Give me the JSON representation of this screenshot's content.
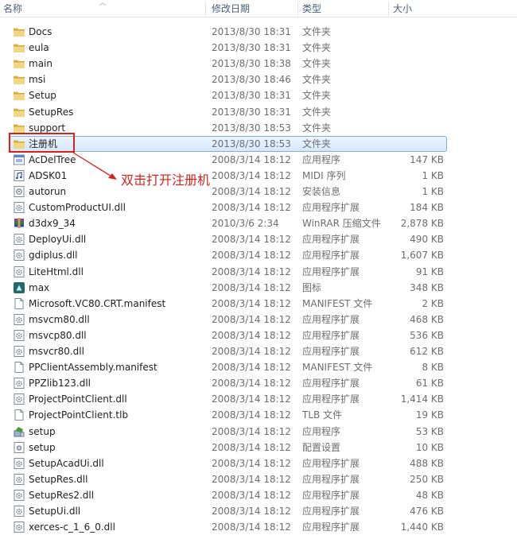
{
  "columns": {
    "name": "名称",
    "date": "修改日期",
    "type": "类型",
    "size": "大小"
  },
  "annotation": {
    "text": "双击打开注册机",
    "color": "#d9211c"
  },
  "colors": {
    "selection_border": "#84acdd",
    "folder": "#e9c45a",
    "header_text": "#4c607a"
  },
  "files": [
    {
      "name": "Docs",
      "date": "2013/8/30 18:31",
      "type": "文件夹",
      "size": "",
      "icon": "folder-icon"
    },
    {
      "name": "eula",
      "date": "2013/8/30 18:31",
      "type": "文件夹",
      "size": "",
      "icon": "folder-icon"
    },
    {
      "name": "main",
      "date": "2013/8/30 18:38",
      "type": "文件夹",
      "size": "",
      "icon": "folder-icon"
    },
    {
      "name": "msi",
      "date": "2013/8/30 18:46",
      "type": "文件夹",
      "size": "",
      "icon": "folder-icon"
    },
    {
      "name": "Setup",
      "date": "2013/8/30 18:31",
      "type": "文件夹",
      "size": "",
      "icon": "folder-icon"
    },
    {
      "name": "SetupRes",
      "date": "2013/8/30 18:31",
      "type": "文件夹",
      "size": "",
      "icon": "folder-icon"
    },
    {
      "name": "support",
      "date": "2013/8/30 18:53",
      "type": "文件夹",
      "size": "",
      "icon": "folder-icon"
    },
    {
      "name": "注册机",
      "date": "2013/8/30 18:53",
      "type": "文件夹",
      "size": "",
      "icon": "folder-icon",
      "selected": true
    },
    {
      "name": "AcDelTree",
      "date": "2008/3/14 18:12",
      "type": "应用程序",
      "size": "147 KB",
      "icon": "exe-icon"
    },
    {
      "name": "ADSK01",
      "date": "2008/3/14 18:12",
      "type": "MIDI 序列",
      "size": "1 KB",
      "icon": "midi-icon"
    },
    {
      "name": "autorun",
      "date": "2008/3/14 18:12",
      "type": "安装信息",
      "size": "1 KB",
      "icon": "inf-icon"
    },
    {
      "name": "CustomProductUI.dll",
      "date": "2008/3/14 18:12",
      "type": "应用程序扩展",
      "size": "184 KB",
      "icon": "dll-icon"
    },
    {
      "name": "d3dx9_34",
      "date": "2010/3/6 2:34",
      "type": "WinRAR 压缩文件",
      "size": "2,878 KB",
      "icon": "rar-icon"
    },
    {
      "name": "DeployUi.dll",
      "date": "2008/3/14 18:12",
      "type": "应用程序扩展",
      "size": "490 KB",
      "icon": "dll-icon"
    },
    {
      "name": "gdiplus.dll",
      "date": "2008/3/14 18:12",
      "type": "应用程序扩展",
      "size": "1,607 KB",
      "icon": "dll-icon"
    },
    {
      "name": "LiteHtml.dll",
      "date": "2008/3/14 18:12",
      "type": "应用程序扩展",
      "size": "91 KB",
      "icon": "dll-icon"
    },
    {
      "name": "max",
      "date": "2008/3/14 18:12",
      "type": "图标",
      "size": "348 KB",
      "icon": "max-icon"
    },
    {
      "name": "Microsoft.VC80.CRT.manifest",
      "date": "2008/3/14 18:12",
      "type": "MANIFEST 文件",
      "size": "2 KB",
      "icon": "file-icon"
    },
    {
      "name": "msvcm80.dll",
      "date": "2008/3/14 18:12",
      "type": "应用程序扩展",
      "size": "468 KB",
      "icon": "dll-icon"
    },
    {
      "name": "msvcp80.dll",
      "date": "2008/3/14 18:12",
      "type": "应用程序扩展",
      "size": "536 KB",
      "icon": "dll-icon"
    },
    {
      "name": "msvcr80.dll",
      "date": "2008/3/14 18:12",
      "type": "应用程序扩展",
      "size": "612 KB",
      "icon": "dll-icon"
    },
    {
      "name": "PPClientAssembly.manifest",
      "date": "2008/3/14 18:12",
      "type": "MANIFEST 文件",
      "size": "8 KB",
      "icon": "file-icon"
    },
    {
      "name": "PPZlib123.dll",
      "date": "2008/3/14 18:12",
      "type": "应用程序扩展",
      "size": "61 KB",
      "icon": "dll-icon"
    },
    {
      "name": "ProjectPointClient.dll",
      "date": "2008/3/14 18:12",
      "type": "应用程序扩展",
      "size": "1,414 KB",
      "icon": "dll-icon"
    },
    {
      "name": "ProjectPointClient.tlb",
      "date": "2008/3/14 18:12",
      "type": "TLB 文件",
      "size": "19 KB",
      "icon": "file-icon"
    },
    {
      "name": "setup",
      "date": "2008/3/14 18:12",
      "type": "应用程序",
      "size": "53 KB",
      "icon": "setup-icon"
    },
    {
      "name": "setup",
      "date": "2008/3/14 18:12",
      "type": "配置设置",
      "size": "10 KB",
      "icon": "ini-icon"
    },
    {
      "name": "SetupAcadUi.dll",
      "date": "2008/3/14 18:12",
      "type": "应用程序扩展",
      "size": "488 KB",
      "icon": "dll-icon"
    },
    {
      "name": "SetupRes.dll",
      "date": "2008/3/14 18:12",
      "type": "应用程序扩展",
      "size": "250 KB",
      "icon": "dll-icon"
    },
    {
      "name": "SetupRes2.dll",
      "date": "2008/3/14 18:12",
      "type": "应用程序扩展",
      "size": "48 KB",
      "icon": "dll-icon"
    },
    {
      "name": "SetupUi.dll",
      "date": "2008/3/14 18:12",
      "type": "应用程序扩展",
      "size": "476 KB",
      "icon": "dll-icon"
    },
    {
      "name": "xerces-c_1_6_0.dll",
      "date": "2008/3/14 18:12",
      "type": "应用程序扩展",
      "size": "1,440 KB",
      "icon": "dll-icon"
    }
  ]
}
